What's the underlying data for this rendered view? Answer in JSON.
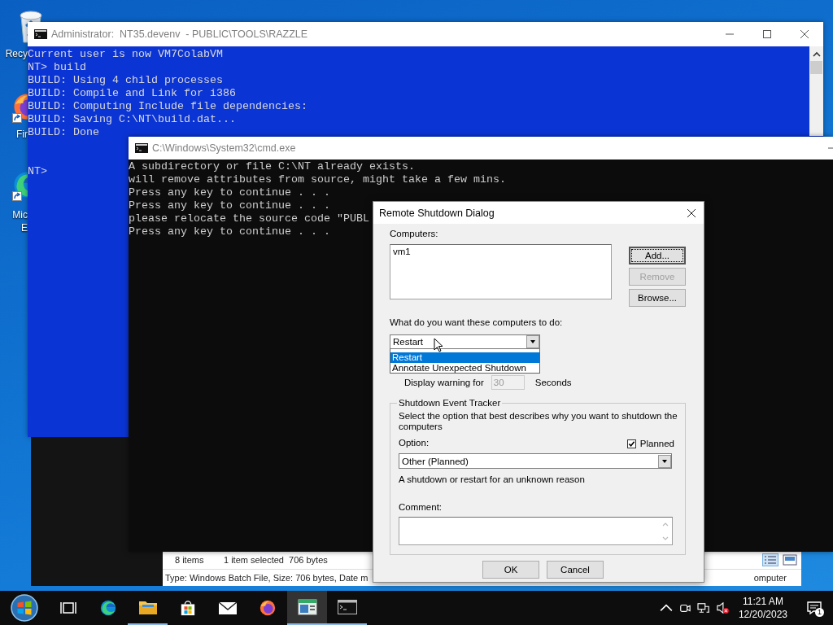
{
  "desktop_icons": [
    {
      "kind": "recycle_bin",
      "label_lines": [
        "Recy"
      ]
    },
    {
      "kind": "firefox",
      "label_lines": [
        "Fir"
      ]
    },
    {
      "kind": "edge",
      "label_lines": [
        "Mic",
        "E"
      ]
    }
  ],
  "console_window": {
    "title": "Administrator:  NT35.devenv  - PUBLIC\\TOOLS\\RAZZLE",
    "lines": [
      "Current user is now VM7ColabVM",
      "NT> build",
      "BUILD: Using 4 child processes",
      "BUILD: Compile and Link for i386",
      "BUILD: Computing Include file dependencies:",
      "BUILD: Saving C:\\NT\\build.dat...",
      "BUILD: Done"
    ],
    "prompt": "NT>"
  },
  "explorer_status_bar": {
    "item_count": "8 items",
    "selection": "1 item selected  706 bytes",
    "details": "Type: Windows Batch File, Size: 706 bytes, Date m",
    "zone": "omputer"
  },
  "cmd_window": {
    "title": "C:\\Windows\\System32\\cmd.exe",
    "lines": [
      "A subdirectory or file C:\\NT already exists.",
      "will remove attributes from source, might take a few mins.",
      "Press any key to continue . . .",
      "Press any key to continue . . .",
      "please relocate the source code \"PUBL",
      "Press any key to continue . . ."
    ]
  },
  "dialog": {
    "title": "Remote Shutdown Dialog",
    "computers_label": "Computers:",
    "computers": [
      "vm1"
    ],
    "buttons": [
      {
        "label": "Add...",
        "focused": true,
        "disabled": false
      },
      {
        "label": "Remove",
        "focused": false,
        "disabled": true
      },
      {
        "label": "Browse...",
        "focused": false,
        "disabled": false
      }
    ],
    "action_label": "What do you want these computers to do:",
    "action": {
      "value": "Restart",
      "expanded": true,
      "options": [
        {
          "label": "Restart",
          "selected": true
        },
        {
          "label": "Annotate Unexpected Shutdown",
          "selected": false
        }
      ]
    },
    "warning": {
      "label": "Display warning for",
      "value": "30",
      "disabled": true,
      "unit": "Seconds"
    },
    "tracker": {
      "title": "Shutdown Event Tracker",
      "description": "Select the option that best describes why you want to shutdown the computers",
      "option_label": "Option:",
      "planned": {
        "label": "Planned",
        "checked": true
      },
      "option_value": "Other (Planned)",
      "option_description": "A shutdown or restart for an unknown reason",
      "comment_label": "Comment:"
    },
    "footer_buttons": [
      {
        "label": "OK"
      },
      {
        "label": "Cancel"
      }
    ]
  },
  "taskbar": {
    "items": [
      {
        "kind": "start",
        "selected": false,
        "running": false
      },
      {
        "kind": "task_view",
        "selected": false,
        "running": false
      },
      {
        "kind": "edge",
        "selected": false,
        "running": false
      },
      {
        "kind": "explorer",
        "selected": false,
        "running": true
      },
      {
        "kind": "store",
        "selected": false,
        "running": false
      },
      {
        "kind": "mail",
        "selected": false,
        "running": false
      },
      {
        "kind": "firefox",
        "selected": false,
        "running": false
      },
      {
        "kind": "app_window",
        "selected": true,
        "running": true
      },
      {
        "kind": "cmd",
        "selected": false,
        "running": true
      }
    ],
    "tray": [
      {
        "kind": "chevron"
      },
      {
        "kind": "meet"
      },
      {
        "kind": "network"
      },
      {
        "kind": "volume_muted"
      }
    ],
    "time": "11:21 AM",
    "date": "12/20/2023",
    "notifications": "1"
  }
}
